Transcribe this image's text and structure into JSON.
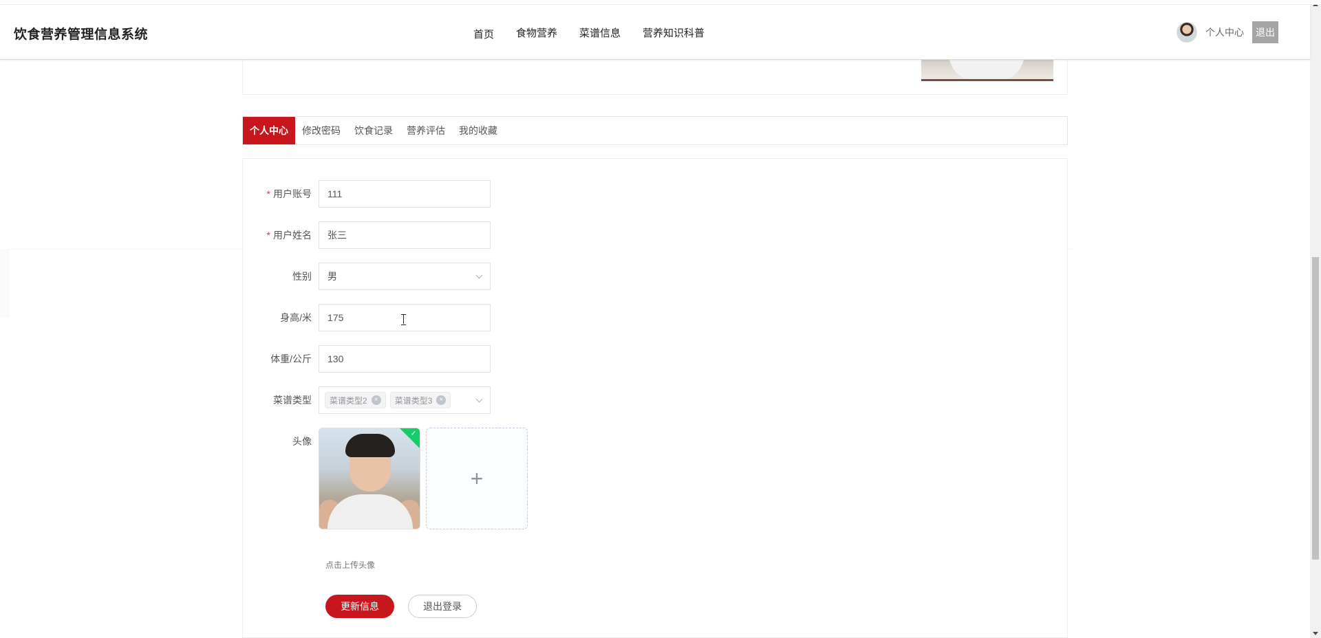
{
  "header": {
    "site_title": "饮食营养管理信息系统",
    "nav": [
      "首页",
      "食物营养",
      "菜谱信息",
      "营养知识科普"
    ],
    "user_center": "个人中心",
    "logout": "退出"
  },
  "tabs": [
    "个人中心",
    "修改密码",
    "饮食记录",
    "营养评估",
    "我的收藏"
  ],
  "form": {
    "account_label": "用户账号",
    "account_value": "111",
    "name_label": "用户姓名",
    "name_value": "张三",
    "gender_label": "性别",
    "gender_value": "男",
    "height_label": "身高/米",
    "height_value": "175",
    "weight_label": "体重/公斤",
    "weight_value": "130",
    "recipe_type_label": "菜谱类型",
    "recipe_tags": [
      "菜谱类型2",
      "菜谱类型3"
    ],
    "avatar_label": "头像",
    "upload_hint": "点击上传头像",
    "update_button": "更新信息",
    "logout_button": "退出登录"
  },
  "colors": {
    "primary_red": "#c8161d",
    "required_star": "#e3363b",
    "success_green": "#13ce66"
  },
  "icons": {
    "upload": "plus-icon",
    "remove_tag": "close-circle-icon",
    "dropdown": "chevron-down-icon",
    "uploaded": "check-icon"
  }
}
